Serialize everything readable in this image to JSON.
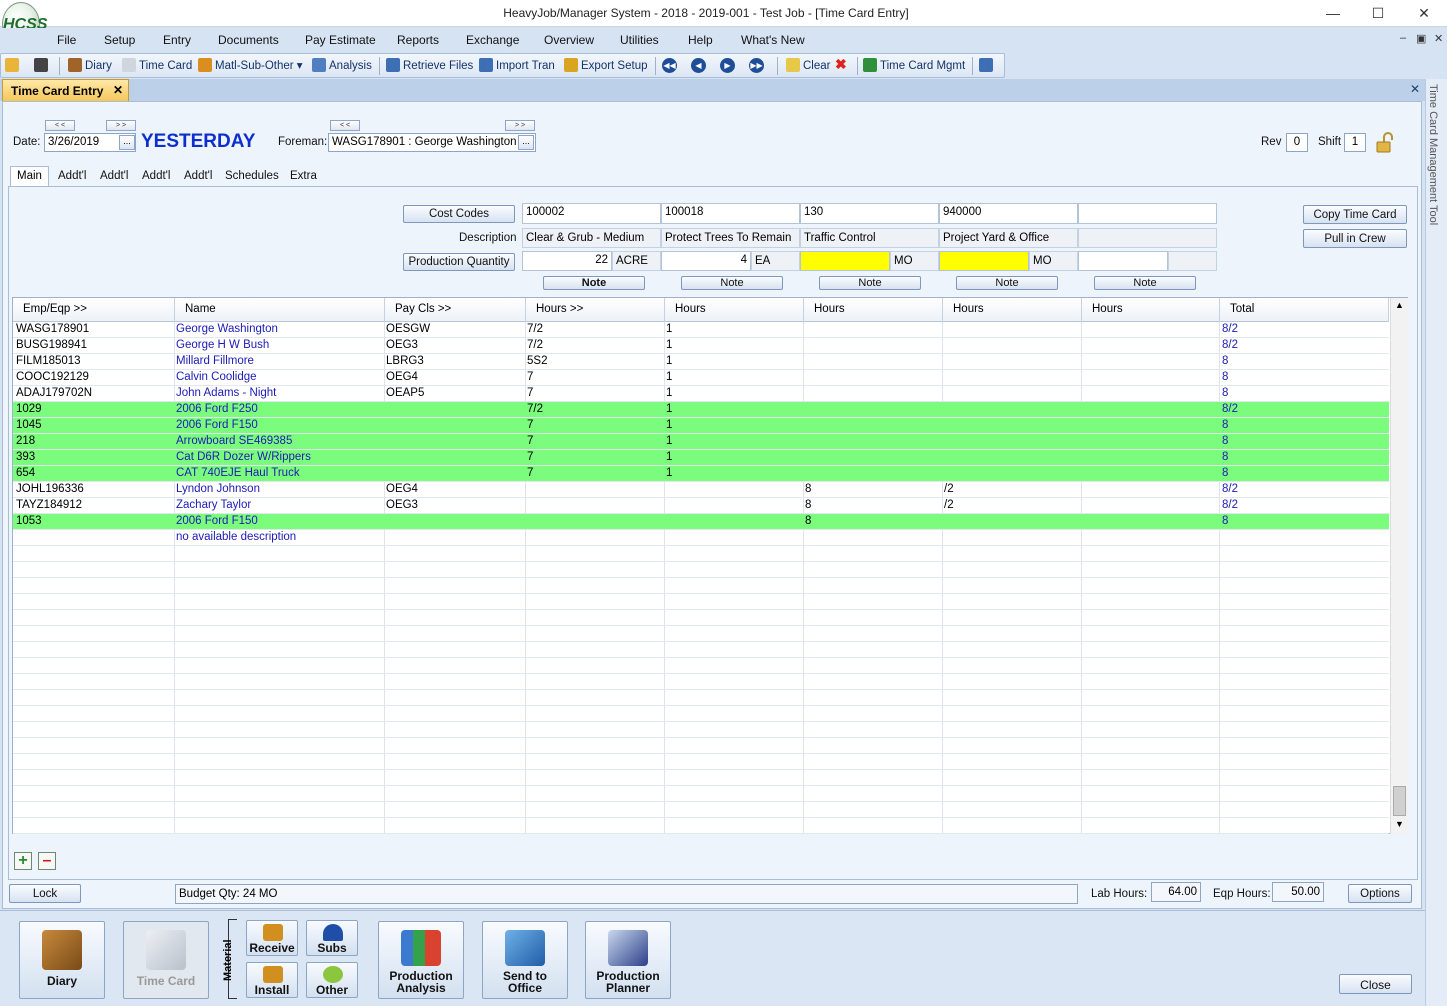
{
  "window": {
    "title": "HeavyJob/Manager System - 2018 - 2019-001 - Test Job - [Time Card Entry]",
    "logo": "HCSS"
  },
  "menu": [
    "File",
    "Setup",
    "Entry",
    "Documents",
    "Pay Estimate",
    "Reports",
    "Exchange",
    "Overview",
    "Utilities",
    "Help",
    "What's New"
  ],
  "toolbar": {
    "diary": "Diary",
    "time_card": "Time Card",
    "matl": "Matl-Sub-Other",
    "analysis": "Analysis",
    "retrieve": "Retrieve Files",
    "import": "Import Tran",
    "export": "Export Setup",
    "clear": "Clear",
    "tcm": "Time Card Mgmt"
  },
  "doc_tab": "Time Card Entry",
  "side_panel": "Time Card Management Tool",
  "header": {
    "date_label": "Date:",
    "date": "3/26/2019",
    "day": "YESTERDAY",
    "foreman_label": "Foreman:",
    "foreman": "WASG178901 : George Washington",
    "rev_label": "Rev",
    "rev": "0",
    "shift_label": "Shift",
    "shift": "1"
  },
  "subtabs": [
    "Main",
    "Addt'l",
    "Addt'l",
    "Addt'l",
    "Addt'l",
    "Schedules",
    "Extra"
  ],
  "costcodes": {
    "btn_cost": "Cost Codes",
    "lbl_desc": "Description",
    "btn_prod": "Production Quantity",
    "note": "Note",
    "cols": [
      {
        "code": "100002",
        "desc": "Clear & Grub - Medium",
        "qty": "22",
        "unit": "ACRE"
      },
      {
        "code": "100018",
        "desc": "Protect Trees To Remain",
        "qty": "4",
        "unit": "EA"
      },
      {
        "code": "130",
        "desc": "Traffic Control",
        "qty": "",
        "unit": "MO"
      },
      {
        "code": "940000",
        "desc": "Project Yard & Office",
        "qty": "",
        "unit": "MO"
      },
      {
        "code": "",
        "desc": "",
        "qty": "",
        "unit": ""
      }
    ]
  },
  "right_buttons": {
    "copy": "Copy Time Card",
    "pull": "Pull in Crew"
  },
  "grid": {
    "headers": [
      "Emp/Eqp >>",
      "Name",
      "Pay Cls >>",
      "Hours >>",
      "Hours",
      "Hours",
      "Hours",
      "Hours",
      "Total"
    ],
    "rows": [
      {
        "c": [
          "WASG178901",
          "George Washington",
          "OESGW",
          "7/2",
          "1",
          "",
          "",
          "",
          "8/2"
        ],
        "g": false
      },
      {
        "c": [
          "BUSG198941",
          "George H W Bush",
          "OEG3",
          "7/2",
          "1",
          "",
          "",
          "",
          "8/2"
        ],
        "g": false
      },
      {
        "c": [
          "FILM185013",
          "Millard Fillmore",
          "LBRG3",
          "5S2",
          "1",
          "",
          "",
          "",
          "8"
        ],
        "g": false
      },
      {
        "c": [
          "COOC192129",
          "Calvin Coolidge",
          "OEG4",
          "7",
          "1",
          "",
          "",
          "",
          "8"
        ],
        "g": false
      },
      {
        "c": [
          "ADAJ179702N",
          "John Adams - Night",
          "OEAP5",
          "7",
          "1",
          "",
          "",
          "",
          "8"
        ],
        "g": false
      },
      {
        "c": [
          "1029",
          "2006 Ford F250",
          "",
          "7/2",
          "1",
          "",
          "",
          "",
          "8/2"
        ],
        "g": true
      },
      {
        "c": [
          "1045",
          "2006 Ford F150",
          "",
          "7",
          "1",
          "",
          "",
          "",
          "8"
        ],
        "g": true
      },
      {
        "c": [
          "218",
          "Arrowboard SE469385",
          "",
          "7",
          "1",
          "",
          "",
          "",
          "8"
        ],
        "g": true
      },
      {
        "c": [
          "393",
          "Cat D6R Dozer W/Rippers",
          "",
          "7",
          "1",
          "",
          "",
          "",
          "8"
        ],
        "g": true
      },
      {
        "c": [
          "654",
          "CAT 740EJE Haul Truck",
          "",
          "7",
          "1",
          "",
          "",
          "",
          "8"
        ],
        "g": true
      },
      {
        "c": [
          "JOHL196336",
          "Lyndon Johnson",
          "OEG4",
          "",
          "",
          "8",
          "/2",
          "",
          "8/2"
        ],
        "g": false
      },
      {
        "c": [
          "TAYZ184912",
          "Zachary Taylor",
          "OEG3",
          "",
          "",
          "8",
          "/2",
          "",
          "8/2"
        ],
        "g": false
      },
      {
        "c": [
          "1053",
          "2006 Ford F150",
          "",
          "",
          "",
          "8",
          "",
          "",
          "8"
        ],
        "g": true
      },
      {
        "c": [
          "",
          "no available description",
          "",
          "",
          "",
          "",
          "",
          "",
          ""
        ],
        "g": false
      }
    ]
  },
  "footer": {
    "lock": "Lock",
    "budget": "Budget Qty:  24 MO",
    "lab_label": "Lab Hours:",
    "lab": "64.00",
    "eqp_label": "Eqp Hours:",
    "eqp": "50.00",
    "options": "Options"
  },
  "bottom": {
    "diary": "Diary",
    "time_card": "Time Card",
    "material": "Material",
    "receive": "Receive",
    "subs": "Subs",
    "install": "Install",
    "other": "Other",
    "prod_analysis_1": "Production",
    "prod_analysis_2": "Analysis",
    "send_1": "Send to",
    "send_2": "Office",
    "planner_1": "Production",
    "planner_2": "Planner",
    "close": "Close"
  }
}
